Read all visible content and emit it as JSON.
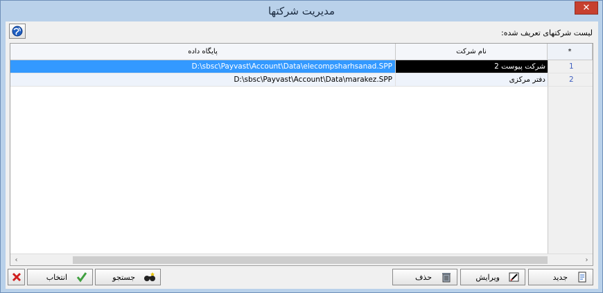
{
  "window": {
    "title": "مدیریت شرکتها",
    "close_glyph": "✕"
  },
  "list_label": "لیست شرکتهای تعریف شده:",
  "table": {
    "headers": {
      "db": "پایگاه داده",
      "name": "نام شرکت",
      "star": "*"
    },
    "rows": [
      {
        "db": "D:\\sbsc\\Payvast\\Account\\Data\\elecompsharhsanad.SPP",
        "name": "شرکت پیوست 2",
        "idx": "1"
      },
      {
        "db": "D:\\sbsc\\Payvast\\Account\\Data\\marakez.SPP",
        "name": "دفتر مرکزی",
        "idx": "2"
      }
    ]
  },
  "buttons": {
    "new": "جدید",
    "edit": "ویرایش",
    "delete": "حذف",
    "search": "جستجو",
    "select": "انتخاب"
  },
  "icons": {
    "globe": "globe-icon",
    "new": "new-document-icon",
    "edit": "edit-icon",
    "delete": "trash-icon",
    "search": "binoculars-icon",
    "select": "checkmark-icon",
    "cancel": "x-icon"
  },
  "colors": {
    "selection": "#3399ff",
    "title_bg": "#b9d1ea",
    "close": "#c7402f"
  }
}
